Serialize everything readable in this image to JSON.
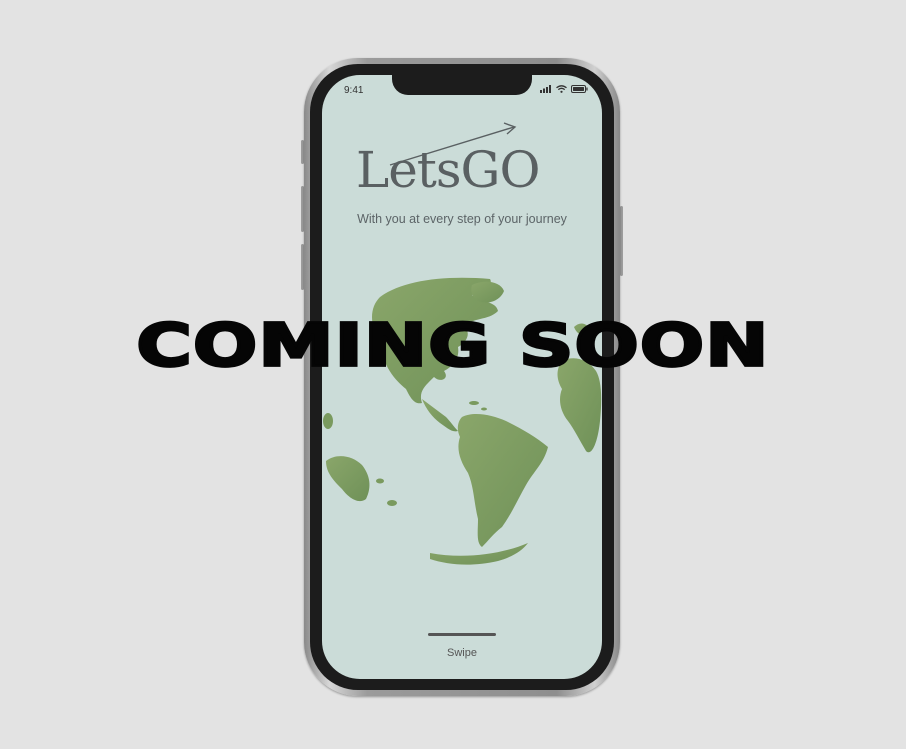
{
  "status_bar": {
    "time": "9:41",
    "icons": [
      "signal-icon",
      "wifi-icon",
      "battery-icon"
    ]
  },
  "app": {
    "logo_text": "LetsGO",
    "tagline": "With you at every step of your journey",
    "swipe_label": "Swipe"
  },
  "overlay": {
    "text": "COMING SOON"
  },
  "colors": {
    "page_background": "#e3e3e3",
    "screen_background": "#cbdcd8",
    "land": "#7a9a5e",
    "overlay_text": "#050505"
  }
}
